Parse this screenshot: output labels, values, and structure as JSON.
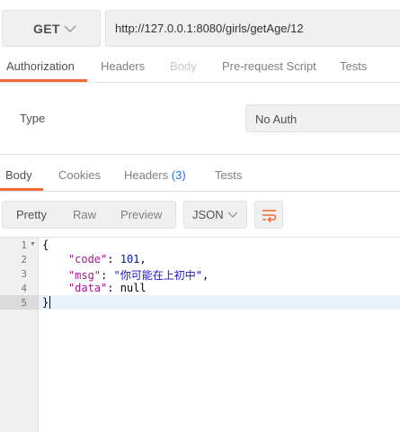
{
  "request": {
    "method": "GET",
    "url": "http://127.0.0.1:8080/girls/getAge/12"
  },
  "request_tabs": [
    {
      "label": "Authorization",
      "state": "active"
    },
    {
      "label": "Headers",
      "state": "normal"
    },
    {
      "label": "Body",
      "state": "disabled"
    },
    {
      "label": "Pre-request Script",
      "state": "normal"
    },
    {
      "label": "Tests",
      "state": "normal"
    }
  ],
  "auth": {
    "type_label": "Type",
    "type_value": "No Auth"
  },
  "response_tabs": {
    "body": "Body",
    "cookies": "Cookies",
    "headers": "Headers",
    "headers_count": "(3)",
    "tests": "Tests"
  },
  "view": {
    "modes": [
      "Pretty",
      "Raw",
      "Preview"
    ],
    "active_mode": "Pretty",
    "format": "JSON",
    "wrap_icon": "wrap-lines-icon"
  },
  "code": {
    "line_numbers": [
      "1",
      "2",
      "3",
      "4",
      "5"
    ],
    "open_brace": "{",
    "close_brace": "}",
    "lines": [
      {
        "key": "\"code\"",
        "value": "101",
        "value_type": "number",
        "trailing": ","
      },
      {
        "key": "\"msg\"",
        "value": "\"你可能在上初中\"",
        "value_type": "string",
        "trailing": ","
      },
      {
        "key": "\"data\"",
        "value": "null",
        "value_type": "null",
        "trailing": ""
      }
    ]
  },
  "colors": {
    "accent": "#f26b3a",
    "badge": "#2f6fd6",
    "json_key": "#a11a8a",
    "json_string": "#2018c4",
    "json_number": "#0a1a9a"
  }
}
